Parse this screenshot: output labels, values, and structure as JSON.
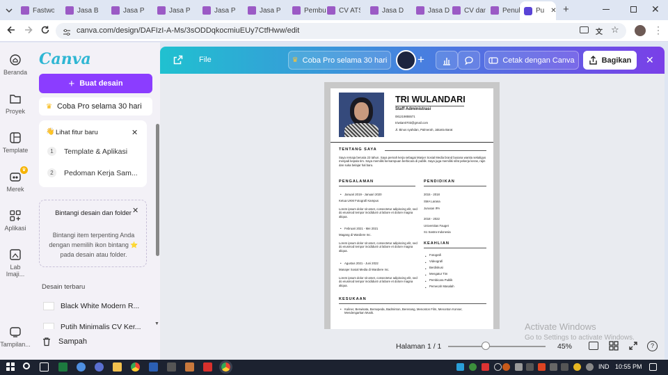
{
  "browser": {
    "tabs": [
      {
        "label": "Fastwo",
        "active": false
      },
      {
        "label": "Jasa Bu",
        "active": false
      },
      {
        "label": "Jasa Pe",
        "active": false
      },
      {
        "label": "Jasa Pe",
        "active": false
      },
      {
        "label": "Jasa Pe",
        "active": false
      },
      {
        "label": "Jasa Pe",
        "active": false
      },
      {
        "label": "Pembu",
        "active": false
      },
      {
        "label": "CV ATS",
        "active": false
      },
      {
        "label": "Jasa De",
        "active": false
      },
      {
        "label": "Jasa De",
        "active": false
      },
      {
        "label": "CV dan",
        "active": false
      },
      {
        "label": "Penulis",
        "active": false
      },
      {
        "label": "Pu",
        "active": true
      }
    ],
    "url": "canva.com/design/DAFIzI-A-Ms/3sODDqkocmiuEUy7CtfHww/edit"
  },
  "rail": {
    "items": [
      {
        "label": "Beranda",
        "icon": "home-icon"
      },
      {
        "label": "Proyek",
        "icon": "folder-icon"
      },
      {
        "label": "Template",
        "icon": "template-icon"
      },
      {
        "label": "Merek",
        "icon": "brand-icon"
      },
      {
        "label": "Aplikasi",
        "icon": "apps-icon"
      },
      {
        "label": "Lab Imaji...",
        "icon": "lab-icon"
      },
      {
        "label": "Tampilan...",
        "icon": "display-icon"
      }
    ]
  },
  "panel": {
    "logo": "Canva",
    "create_label": "Buat desain",
    "try_pro": "Coba Pro selama 30 hari",
    "features": {
      "title": "Lihat fitur baru",
      "items": [
        {
          "num": "1",
          "label": "Template & Aplikasi"
        },
        {
          "num": "2",
          "label": "Pedoman Kerja Sam..."
        }
      ]
    },
    "star_card": {
      "title": "Bintangi desain dan folder",
      "body": "Bintangi item terpenting Anda dengan memilih ikon bintang ⭐ pada desain atau folder."
    },
    "recent_heading": "Desain terbaru",
    "recent": [
      "Black White Modern R...",
      "Putih Minimalis CV Ker..."
    ],
    "trash": "Sampah"
  },
  "header": {
    "file": "File",
    "try_pro": "Coba Pro selama 30 hari",
    "print": "Cetak dengan Canva",
    "share": "Bagikan"
  },
  "cv": {
    "name": "TRI WULANDARI",
    "role": "Staff Administrasi",
    "phone": "081219855571",
    "email": "triwtian0703@gmail.com",
    "address": "Jl. Binus syahdan, Palmerah, Jakarta Barat",
    "about_h": "TENTANG SAYA",
    "about": "Saya remaja berusia 23 tahun. Saya pernah kerja sebagai Manjer Sosial Media brand busana wanita sekaligus menjadi kepala tim. Saya memiliki kemampuan berbicara di publik. Saya juga memiliki sifat pekerja keras, rajin dan suka belajar hal baru.",
    "exp_h": "PENGALAMAN",
    "exp": [
      {
        "date": "Januari 2019 - Januari 2020",
        "title": "Ketua UKM Fotografi Kampus",
        "desc": "Lorem ipsum dolor sit amet, consectetur adipiscing elit, sed do eiusmod tempor incididunt ut labore et dolore magna aliqua."
      },
      {
        "date": "Februari 2021 - Mei 2021",
        "title": "Magang di Wardiere Inc.",
        "desc": "Lorem ipsum dolor sit amet, consectetur adipiscing elit, sed do eiusmod tempor incididunt ut labore et dolore magna aliqua."
      },
      {
        "date": "Agustus 2021 - Juni 2022",
        "title": "Manajer Sosial Media di Wardiere Inc.",
        "desc": "Lorem ipsum dolor sit amet, consectetur adipiscing elit, sed do eiusmod tempor incididunt ut labore et dolore magna aliqua."
      }
    ],
    "edu_h": "PENDIDIKAN",
    "edu": [
      {
        "years": "2015 - 2018",
        "school": "SMA Larana",
        "major": "Jurusan IPA"
      },
      {
        "years": "2018 - 2022",
        "school": "Universitas Fauget",
        "major": "S1 Sastra Indonesia"
      }
    ],
    "skills_h": "KEAHLIAN",
    "skills": [
      "Fotografi",
      "Videografi",
      "Berdiskusi",
      "Mengatur Tim",
      "Pembicara Publik",
      "Pemecah Masalah"
    ],
    "hobby_h": "KESUKAAN",
    "hobby": "Kuliner, Berwisata, Bersepeda, Badminton, Berenang, Menonton Film, Menonton Konser, Mendengarkan Musik."
  },
  "footer": {
    "page": "Halaman 1 / 1",
    "zoom": "45%",
    "zoom_fraction": 0.45
  },
  "watermark": {
    "title": "Activate Windows",
    "sub": "Go to Settings to activate Windows."
  },
  "taskbar": {
    "lang": "IND",
    "time": "10:55 PM"
  },
  "colors": {
    "accent": "#8b3dff",
    "header_start": "#20c1d0",
    "header_end": "#7a3fe8"
  }
}
